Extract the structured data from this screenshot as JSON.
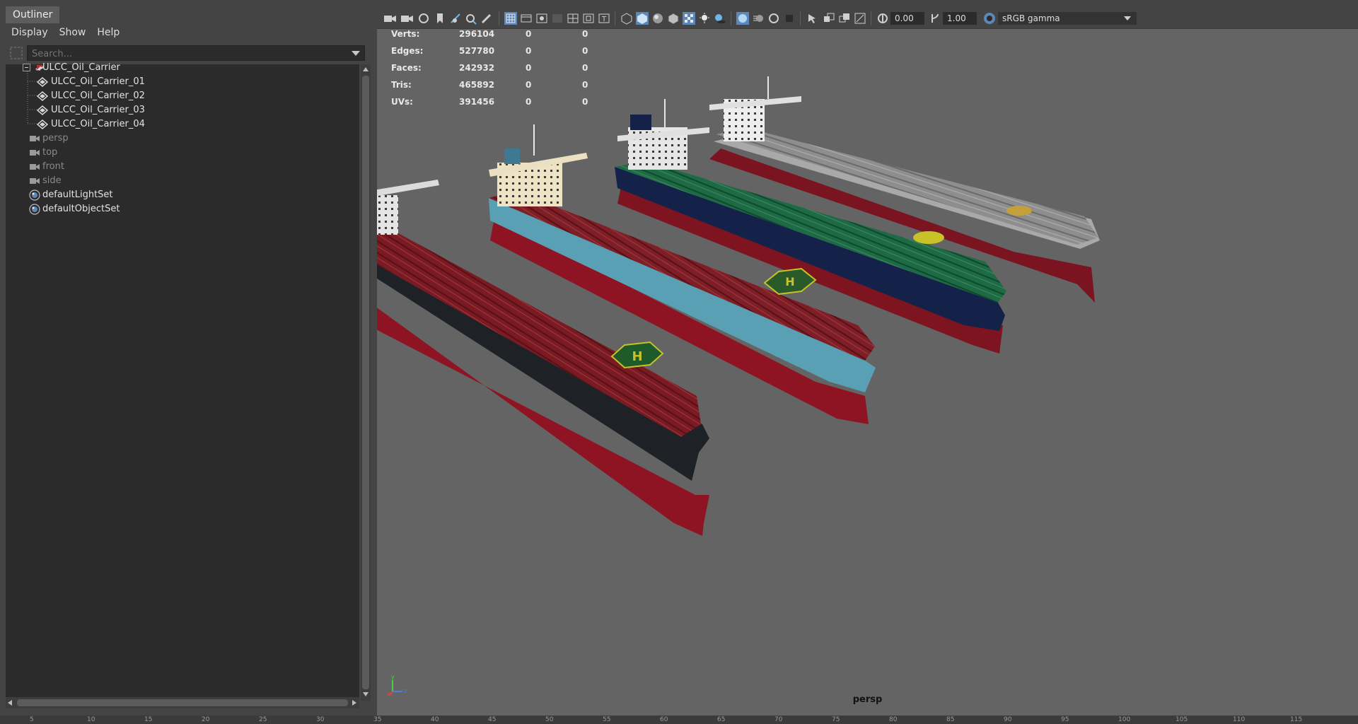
{
  "outliner": {
    "title": "Outliner",
    "menu": [
      "Display",
      "Show",
      "Help"
    ],
    "search_placeholder": "Search...",
    "tree": [
      {
        "label": "ULCC_Oil_Carrier",
        "kind": "group",
        "expanded": true
      },
      {
        "label": "ULCC_Oil_Carrier_01",
        "kind": "mesh"
      },
      {
        "label": "ULCC_Oil_Carrier_02",
        "kind": "mesh"
      },
      {
        "label": "ULCC_Oil_Carrier_03",
        "kind": "mesh"
      },
      {
        "label": "ULCC_Oil_Carrier_04",
        "kind": "mesh"
      },
      {
        "label": "persp",
        "kind": "camera"
      },
      {
        "label": "top",
        "kind": "camera"
      },
      {
        "label": "front",
        "kind": "camera"
      },
      {
        "label": "side",
        "kind": "camera"
      },
      {
        "label": "defaultLightSet",
        "kind": "set"
      },
      {
        "label": "defaultObjectSet",
        "kind": "set"
      }
    ]
  },
  "viewport": {
    "toolbar": {
      "exposure": "0.00",
      "gamma": "1.00",
      "color_space": "sRGB gamma"
    },
    "hud": [
      {
        "label": "Verts:",
        "values": [
          "296104",
          "0",
          "0"
        ]
      },
      {
        "label": "Edges:",
        "values": [
          "527780",
          "0",
          "0"
        ]
      },
      {
        "label": "Faces:",
        "values": [
          "242932",
          "0",
          "0"
        ]
      },
      {
        "label": "Tris:",
        "values": [
          "465892",
          "0",
          "0"
        ]
      },
      {
        "label": "UVs:",
        "values": [
          "391456",
          "0",
          "0"
        ]
      }
    ],
    "camera": "persp",
    "helipad_letter": "H",
    "background_color": "#646464",
    "ships": [
      {
        "name": "ULCC_Oil_Carrier_01",
        "deck_color": "#7a1a22",
        "hull_band_color": "#1e2226",
        "bottom_color": "#8e1424",
        "house_color": "#e4e4e4"
      },
      {
        "name": "ULCC_Oil_Carrier_02",
        "deck_color": "#7e1f27",
        "hull_band_color": "#5aa0b4",
        "bottom_color": "#8e1424",
        "house_color": "#efe3c5"
      },
      {
        "name": "ULCC_Oil_Carrier_03",
        "deck_color": "#1e6a44",
        "hull_band_color": "#14224a",
        "bottom_color": "#7e141f",
        "house_color": "#e6e6e6"
      },
      {
        "name": "ULCC_Oil_Carrier_04",
        "deck_color": "#8e8e8e",
        "hull_band_color": "#a9a9a9",
        "bottom_color": "#7a1420",
        "house_color": "#eeeeee"
      }
    ]
  },
  "timeline": {
    "ticks": [
      "5",
      "10",
      "15",
      "20",
      "25",
      "30",
      "35",
      "40",
      "45",
      "50",
      "55",
      "60",
      "65",
      "70",
      "75",
      "80",
      "85",
      "90",
      "95",
      "100",
      "105",
      "110",
      "115"
    ]
  }
}
